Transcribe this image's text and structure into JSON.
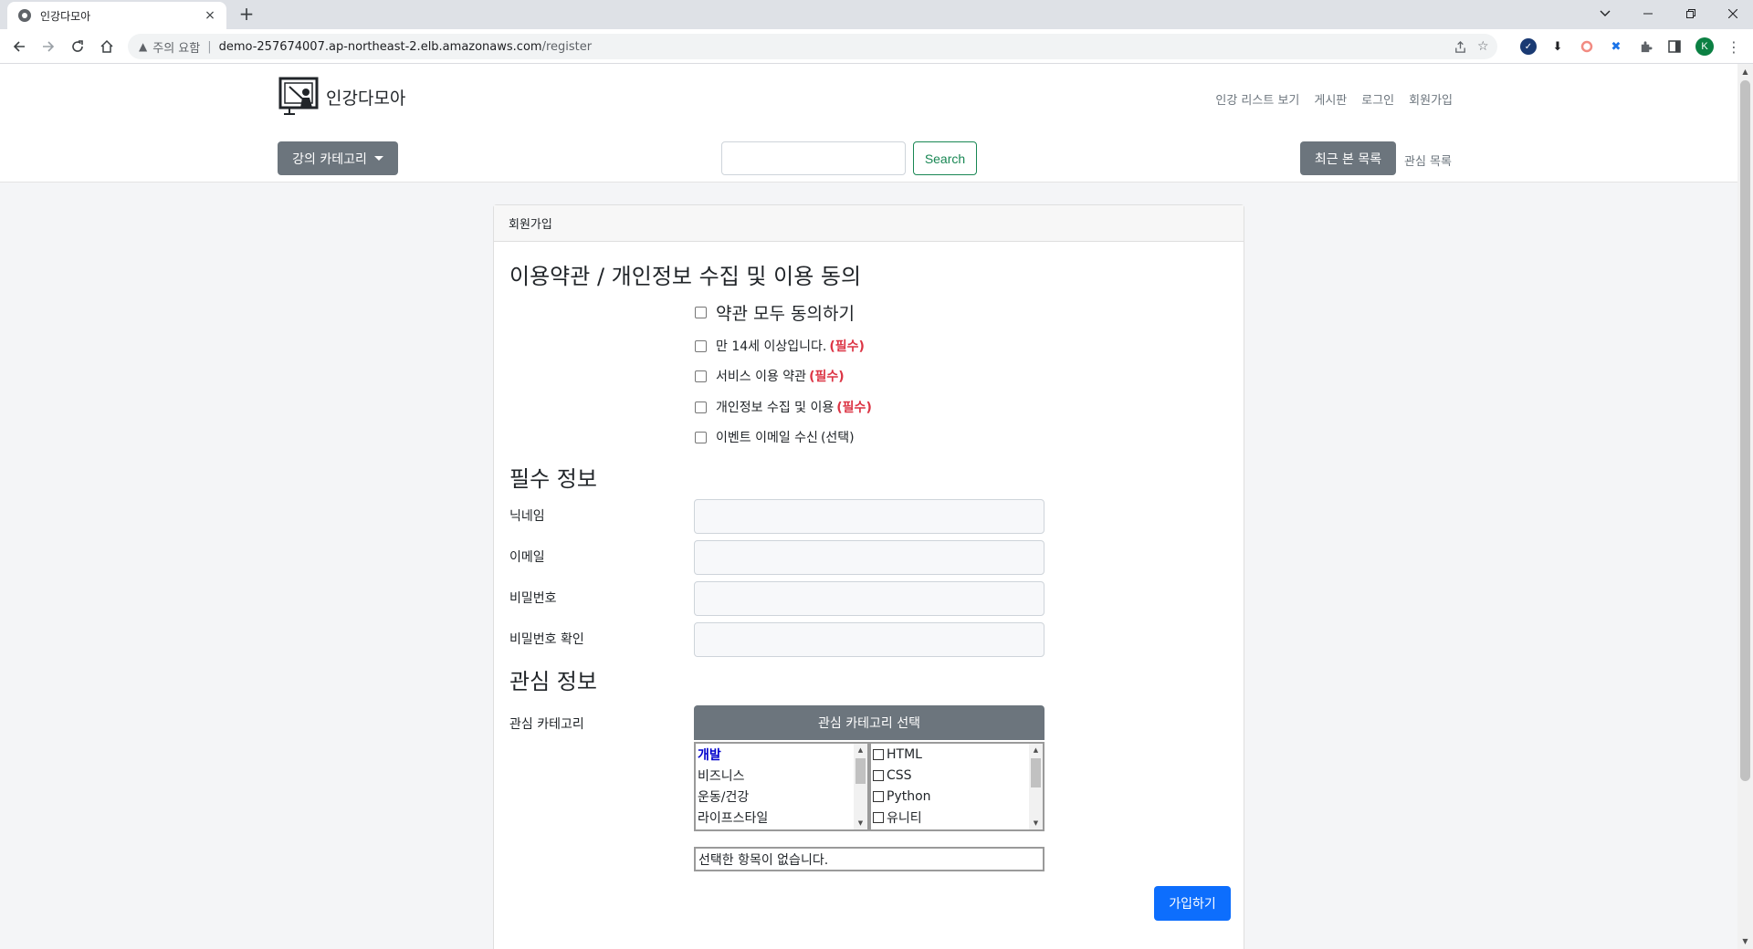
{
  "browser": {
    "tab_title": "인강다모아",
    "tab_close": "×",
    "new_tab": "+",
    "security_warning": "주의 요함",
    "url_host": "demo-257674007.ap-northeast-2.elb.amazonaws.com",
    "url_path": "/register",
    "profile_initial": "K"
  },
  "header": {
    "logo_text": "인강다모아",
    "nav": [
      "인강 리스트 보기",
      "게시판",
      "로그인",
      "회원가입"
    ],
    "category_button": "강의 카테고리",
    "search_button": "Search",
    "recent_button": "최근 본 목록",
    "favorites_link": "관심 목록"
  },
  "form": {
    "card_header": "회원가입",
    "terms_title": "이용약관 / 개인정보 수집 및 이용 동의",
    "agree_all": "약관 모두 동의하기",
    "terms": [
      {
        "label": "만 14세 이상입니다.",
        "tag": "(필수)"
      },
      {
        "label": "서비스 이용 약관",
        "tag": "(필수)"
      },
      {
        "label": "개인정보 수집 및 이용",
        "tag": "(필수)"
      },
      {
        "label": "이벤트 이메일 수신",
        "tag": "(선택)"
      }
    ],
    "required_title": "필수 정보",
    "fields": [
      "닉네임",
      "이메일",
      "비밀번호",
      "비밀번호 확인"
    ],
    "interest_title": "관심 정보",
    "interest_label": "관심 카테고리",
    "interest_button": "관심 카테고리 선택",
    "categories": [
      "개발",
      "비즈니스",
      "운동/건강",
      "라이프스타일"
    ],
    "subcategories": [
      "HTML",
      "CSS",
      "Python",
      "유니티"
    ],
    "selected_text": "선택한 항목이 없습니다.",
    "submit": "가입하기"
  },
  "colors": {
    "secondary": "#6c757d",
    "success": "#198754",
    "primary": "#0d6efd",
    "danger": "#dc3545"
  }
}
